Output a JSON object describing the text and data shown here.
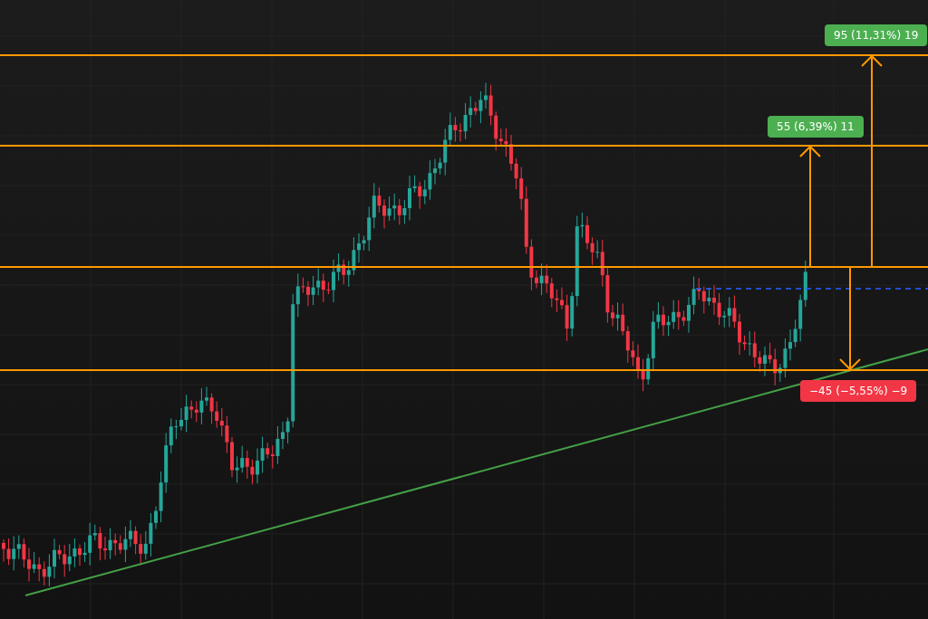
{
  "measurements": [
    {
      "kind": "gain",
      "label": "95 (11,31%) 19"
    },
    {
      "kind": "gain",
      "label": "55 (6,39%) 11"
    },
    {
      "kind": "loss",
      "label": "−45 (−5,55%) −9"
    }
  ]
}
